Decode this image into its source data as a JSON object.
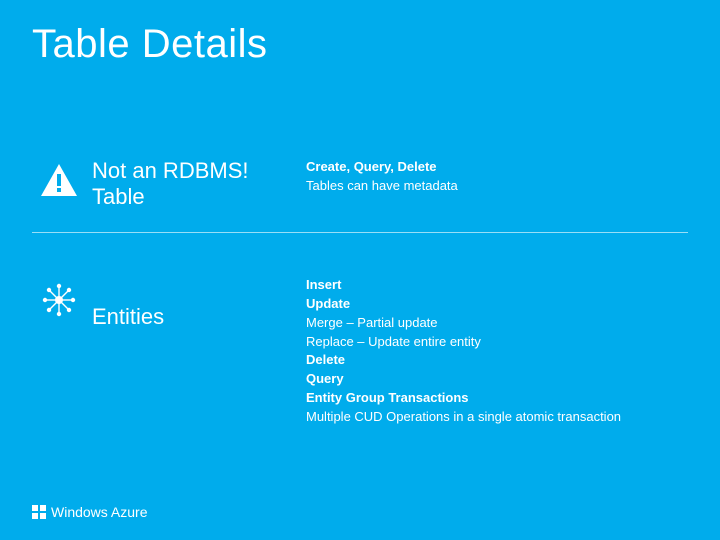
{
  "title": "Table Details",
  "section1": {
    "heading_line1": "Not an RDBMS!",
    "heading_line2": "Table",
    "details_line1": "Create, Query, Delete",
    "details_line2": "Tables can have metadata"
  },
  "section2": {
    "heading": "Entities",
    "d1": "Insert",
    "d2": "Update",
    "d3": "Merge – Partial update",
    "d4": "Replace – Update entire entity",
    "d5": "Delete",
    "d6": "Query",
    "d7": "Entity Group Transactions",
    "d8": "Multiple CUD Operations in a single atomic transaction"
  },
  "footer": {
    "brand": "Windows Azure"
  }
}
